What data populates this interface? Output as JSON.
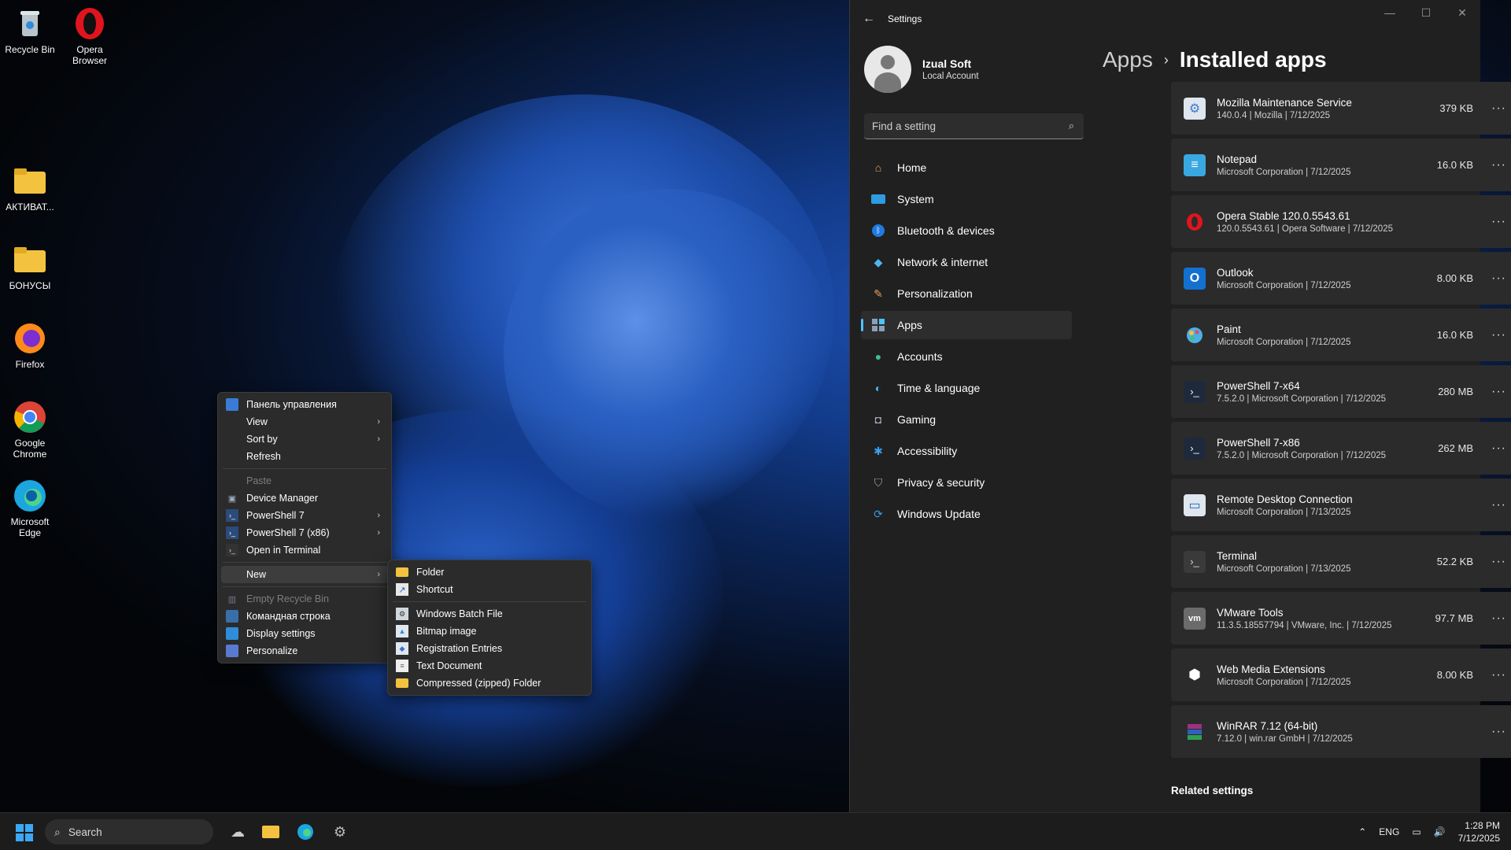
{
  "desktop": {
    "icons": [
      {
        "label": "Recycle Bin",
        "icon": "recycle-bin-icon"
      },
      {
        "label": "Opera Browser",
        "icon": "opera-icon"
      },
      {
        "label": "АКТИВАТ...",
        "icon": "folder-icon"
      },
      {
        "label": "БОНУСЫ",
        "icon": "folder-icon"
      },
      {
        "label": "Firefox",
        "icon": "firefox-icon"
      },
      {
        "label": "Google Chrome",
        "icon": "chrome-icon"
      },
      {
        "label": "Microsoft Edge",
        "icon": "edge-icon"
      }
    ]
  },
  "context_menu": {
    "items": [
      {
        "label": "Панель управления"
      },
      {
        "label": "View"
      },
      {
        "label": "Sort by"
      },
      {
        "label": "Refresh"
      },
      {
        "label": "Paste"
      },
      {
        "label": "Device Manager"
      },
      {
        "label": "PowerShell 7"
      },
      {
        "label": "PowerShell 7 (x86)"
      },
      {
        "label": "Open in Terminal"
      },
      {
        "label": "New"
      },
      {
        "label": "Empty Recycle Bin"
      },
      {
        "label": "Командная строка"
      },
      {
        "label": "Display settings"
      },
      {
        "label": "Personalize"
      }
    ],
    "submenu": [
      {
        "label": "Folder"
      },
      {
        "label": "Shortcut"
      },
      {
        "label": "Windows Batch File"
      },
      {
        "label": "Bitmap image"
      },
      {
        "label": "Registration Entries"
      },
      {
        "label": "Text Document"
      },
      {
        "label": "Compressed (zipped) Folder"
      }
    ]
  },
  "settings": {
    "title": "Settings",
    "user": {
      "name": "Izual Soft",
      "account": "Local Account"
    },
    "search_placeholder": "Find a setting",
    "nav": [
      {
        "label": "Home"
      },
      {
        "label": "System"
      },
      {
        "label": "Bluetooth & devices"
      },
      {
        "label": "Network & internet"
      },
      {
        "label": "Personalization"
      },
      {
        "label": "Apps"
      },
      {
        "label": "Accounts"
      },
      {
        "label": "Time & language"
      },
      {
        "label": "Gaming"
      },
      {
        "label": "Accessibility"
      },
      {
        "label": "Privacy & security"
      },
      {
        "label": "Windows Update"
      }
    ],
    "breadcrumb": {
      "parent": "Apps",
      "current": "Installed apps"
    },
    "apps": [
      {
        "name": "Mozilla Maintenance Service",
        "meta": "140.0.4  |  Mozilla  |  7/12/2025",
        "size": "379 KB"
      },
      {
        "name": "Notepad",
        "meta": "Microsoft Corporation  |  7/12/2025",
        "size": "16.0 KB"
      },
      {
        "name": "Opera Stable 120.0.5543.61",
        "meta": "120.0.5543.61  |  Opera Software  |  7/12/2025",
        "size": ""
      },
      {
        "name": "Outlook",
        "meta": "Microsoft Corporation  |  7/12/2025",
        "size": "8.00 KB"
      },
      {
        "name": "Paint",
        "meta": "Microsoft Corporation  |  7/12/2025",
        "size": "16.0 KB"
      },
      {
        "name": "PowerShell 7-x64",
        "meta": "7.5.2.0  |  Microsoft Corporation  |  7/12/2025",
        "size": "280 MB"
      },
      {
        "name": "PowerShell 7-x86",
        "meta": "7.5.2.0  |  Microsoft Corporation  |  7/12/2025",
        "size": "262 MB"
      },
      {
        "name": "Remote Desktop Connection",
        "meta": "Microsoft Corporation  |  7/13/2025",
        "size": ""
      },
      {
        "name": "Terminal",
        "meta": "Microsoft Corporation  |  7/13/2025",
        "size": "52.2 KB"
      },
      {
        "name": "VMware Tools",
        "meta": "11.3.5.18557794  |  VMware, Inc.  |  7/12/2025",
        "size": "97.7 MB"
      },
      {
        "name": "Web Media Extensions",
        "meta": "Microsoft Corporation  |  7/12/2025",
        "size": "8.00 KB"
      },
      {
        "name": "WinRAR 7.12 (64-bit)",
        "meta": "7.12.0  |  win.rar GmbH  |  7/12/2025",
        "size": ""
      }
    ],
    "related_settings": "Related settings"
  },
  "taskbar": {
    "search": "Search",
    "language": "ENG",
    "time": "1:28 PM",
    "date": "7/12/2025"
  },
  "colors": {
    "accent": "#4cc2ff",
    "window_bg": "#202020",
    "card_bg": "#2b2b2b"
  }
}
